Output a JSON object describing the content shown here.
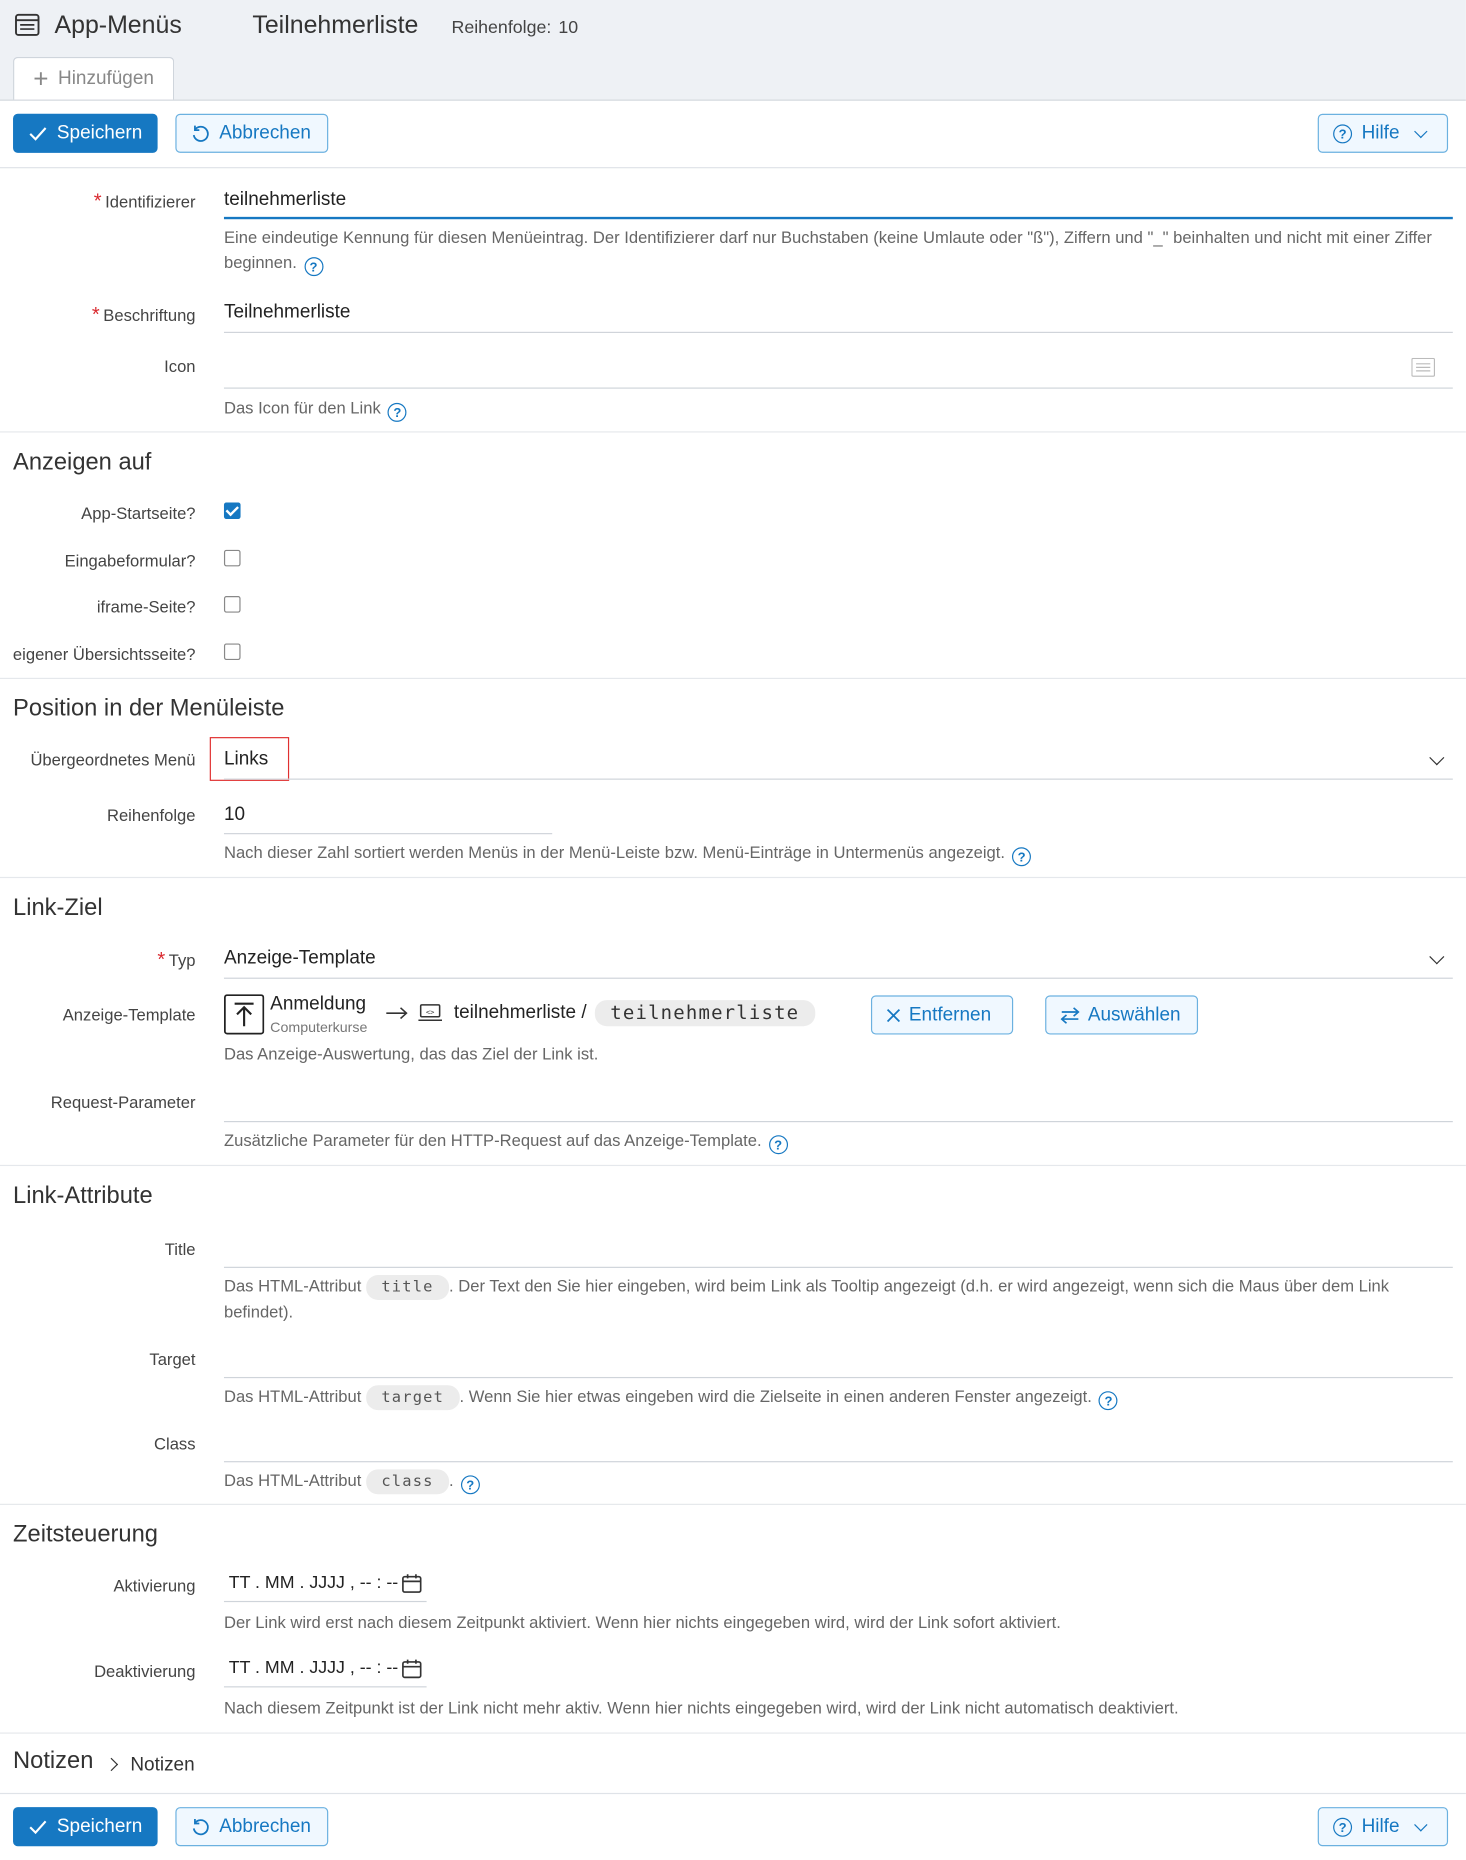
{
  "header": {
    "app_title": "App-Menüs",
    "record_title": "Teilnehmerliste",
    "order_label": "Reihenfolge:",
    "order_value": "10",
    "add_tab": "Hinzufügen"
  },
  "toolbar": {
    "save": "Speichern",
    "cancel": "Abbrechen",
    "help": "Hilfe"
  },
  "form": {
    "identifier": {
      "label": "Identifizierer",
      "value": "teilnehmerliste",
      "help": "Eine eindeutige Kennung für diesen Menüeintrag. Der Identifizierer darf nur Buchstaben (keine Umlaute oder \"ß\"), Ziffern und \"_\" beinhalten und nicht mit einer Ziffer beginnen."
    },
    "caption": {
      "label": "Beschriftung",
      "value": "Teilnehmerliste"
    },
    "icon": {
      "label": "Icon",
      "value": "",
      "help": "Das Icon für den Link"
    }
  },
  "show_on": {
    "title": "Anzeigen auf",
    "items": [
      {
        "label": "App-Startseite?",
        "checked": true
      },
      {
        "label": "Eingabeformular?",
        "checked": false
      },
      {
        "label": "iframe-Seite?",
        "checked": false
      },
      {
        "label": "eigener Übersichtsseite?",
        "checked": false
      }
    ]
  },
  "position": {
    "title": "Position in der Menüleiste",
    "parent_label": "Übergeordnetes Menü",
    "parent_value": "Links",
    "order_label": "Reihenfolge",
    "order_value": "10",
    "order_help": "Nach dieser Zahl sortiert werden Menüs in der Menü-Leiste bzw. Menü-Einträge in Untermenüs angezeigt."
  },
  "link_target": {
    "title": "Link-Ziel",
    "type_label": "Typ",
    "type_value": "Anzeige-Template",
    "template_label": "Anzeige-Template",
    "app_name": "Anmeldung",
    "app_sub": "Computerkurse",
    "template_name": "teilnehmerliste /",
    "template_ident": "teilnehmerliste",
    "remove": "Entfernen",
    "select": "Auswählen",
    "template_help": "Das Anzeige-Auswertung, das das Ziel der Link ist.",
    "params_label": "Request-Parameter",
    "params_value": "",
    "params_help": "Zusätzliche Parameter für den HTTP-Request auf das Anzeige-Template."
  },
  "link_attrs": {
    "title": "Link-Attribute",
    "title_label": "Title",
    "title_help_pre": "Das HTML-Attribut",
    "title_code": "title",
    "title_help_post": ". Der Text den Sie hier eingeben, wird beim Link als Tooltip angezeigt (d.h. er wird angezeigt, wenn sich die Maus über dem Link befindet).",
    "target_label": "Target",
    "target_help_pre": "Das HTML-Attribut",
    "target_code": "target",
    "target_help_post": ". Wenn Sie hier etwas eingeben wird die Zielseite in einen anderen Fenster angezeigt.",
    "class_label": "Class",
    "class_help_pre": "Das HTML-Attribut",
    "class_code": "class",
    "class_help_post": "."
  },
  "timing": {
    "title": "Zeitsteuerung",
    "activation_label": "Aktivierung",
    "activation_value": "TT . MM . JJJJ ,  -- : --",
    "activation_help": "Der Link wird erst nach diesem Zeitpunkt aktiviert. Wenn hier nichts eingegeben wird, wird der Link sofort aktiviert.",
    "deactivation_label": "Deaktivierung",
    "deactivation_value": "TT . MM . JJJJ ,  -- : --",
    "deactivation_help": "Nach diesem Zeitpunkt ist der Link nicht mehr aktiv. Wenn hier nichts eingegeben wird, wird der Link nicht automatisch deaktiviert."
  },
  "notes": {
    "title": "Notizen",
    "link": "Notizen"
  },
  "colors": {
    "primary": "#1678c2",
    "required": "#d9282e",
    "header_bg": "#eef1f5"
  }
}
